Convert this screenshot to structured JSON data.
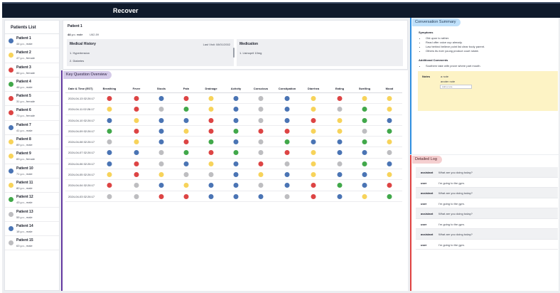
{
  "app": {
    "title": "Recover"
  },
  "colors": {
    "red": "#dd4444",
    "yellow": "#f7d35a",
    "blue": "#4a74b4",
    "green": "#41a84a",
    "gray": "#bdbdc0"
  },
  "sidebar": {
    "title": "Patients List",
    "patients": [
      {
        "name": "Patient 1",
        "info": "44 y.o., male",
        "status": "blue"
      },
      {
        "name": "Patient 2",
        "info": "47 y.o., female",
        "status": "yellow"
      },
      {
        "name": "Patient 3",
        "info": "86 y.o., female",
        "status": "red"
      },
      {
        "name": "Patient 4",
        "info": "46 y.o., male",
        "status": "green"
      },
      {
        "name": "Patient 5",
        "info": "31 y.o., female",
        "status": "red"
      },
      {
        "name": "Patient 6",
        "info": "73 y.o., female",
        "status": "red"
      },
      {
        "name": "Patient 7",
        "info": "41 y.o., male",
        "status": "blue"
      },
      {
        "name": "Patient 8",
        "info": "89 y.o., male",
        "status": "yellow"
      },
      {
        "name": "Patient 9",
        "info": "83 y.o., female",
        "status": "yellow"
      },
      {
        "name": "Patient 10",
        "info": "71 y.o., male",
        "status": "blue"
      },
      {
        "name": "Patient 11",
        "info": "80 y.o., male",
        "status": "yellow"
      },
      {
        "name": "Patient 12",
        "info": "43 y.o., male",
        "status": "green"
      },
      {
        "name": "Patient 13",
        "info": "55 y.o., male",
        "status": "gray"
      },
      {
        "name": "Patient 14",
        "info": "18 y.o., male",
        "status": "blue"
      },
      {
        "name": "Patient 15",
        "info": "63 y.o., male",
        "status": "gray"
      }
    ]
  },
  "patient": {
    "name": "Patient 1",
    "age": "44",
    "age_suffix": "y.o. male",
    "id": "U62-59",
    "medical_history": {
      "title": "Medical History",
      "last_visit": "Last Visit: 08/01/2002",
      "items": [
        "1. Hypertension",
        "2. Diabetes"
      ]
    },
    "medication": {
      "title": "Medication",
      "items": [
        "1. Lisinopril 10mg"
      ]
    }
  },
  "overview": {
    "title": "Key Question Overview",
    "columns": [
      "Date & Time (EST)",
      "Breathing",
      "Fever",
      "Stools",
      "Pain",
      "Drainage",
      "Activity",
      "Conscious",
      "Constipation",
      "Diarrhea",
      "Eating",
      "Swelling",
      "Mood"
    ],
    "rows": [
      {
        "time": "2024-04-13 02:26:17",
        "values": [
          "red",
          "red",
          "blue",
          "red",
          "yellow",
          "blue",
          "gray",
          "blue",
          "yellow",
          "red",
          "yellow",
          "yellow"
        ]
      },
      {
        "time": "2024-04-11 02:26:17",
        "values": [
          "yellow",
          "red",
          "gray",
          "green",
          "yellow",
          "blue",
          "gray",
          "blue",
          "yellow",
          "gray",
          "green",
          "yellow"
        ]
      },
      {
        "time": "2024-04-10 02:26:17",
        "values": [
          "blue",
          "yellow",
          "blue",
          "blue",
          "red",
          "blue",
          "gray",
          "blue",
          "red",
          "yellow",
          "green",
          "blue"
        ]
      },
      {
        "time": "2024-04-09 02:26:17",
        "values": [
          "green",
          "red",
          "blue",
          "yellow",
          "red",
          "green",
          "red",
          "red",
          "yellow",
          "yellow",
          "gray",
          "green"
        ]
      },
      {
        "time": "2024-04-08 02:26:17",
        "values": [
          "gray",
          "yellow",
          "blue",
          "red",
          "green",
          "blue",
          "gray",
          "green",
          "blue",
          "blue",
          "green",
          "yellow"
        ]
      },
      {
        "time": "2024-04-07 02:26:17",
        "values": [
          "blue",
          "blue",
          "gray",
          "green",
          "red",
          "green",
          "gray",
          "red",
          "yellow",
          "blue",
          "blue",
          "gray"
        ]
      },
      {
        "time": "2024-04-06 02:26:17",
        "values": [
          "blue",
          "red",
          "gray",
          "blue",
          "yellow",
          "blue",
          "red",
          "gray",
          "yellow",
          "gray",
          "green",
          "blue"
        ]
      },
      {
        "time": "2024-04-05 02:26:17",
        "values": [
          "yellow",
          "red",
          "yellow",
          "gray",
          "gray",
          "blue",
          "yellow",
          "blue",
          "yellow",
          "blue",
          "blue",
          "yellow"
        ]
      },
      {
        "time": "2024-04-04 02:26:17",
        "values": [
          "red",
          "gray",
          "blue",
          "yellow",
          "blue",
          "blue",
          "gray",
          "blue",
          "red",
          "green",
          "blue",
          "red"
        ]
      },
      {
        "time": "2024-04-03 02:26:17",
        "values": [
          "gray",
          "gray",
          "red",
          "red",
          "blue",
          "blue",
          "blue",
          "gray",
          "red",
          "blue",
          "yellow",
          "green"
        ]
      }
    ]
  },
  "summary": {
    "title": "Conversation Summary",
    "symptoms_label": "Symptoms",
    "symptoms": [
      "Old upon to rather.",
      "Read offer voice cup already.",
      "Law behind believe point list clear body parent.",
      "Others its ever young product court rotate."
    ],
    "additional_label": "Additional Comments",
    "additional": [
      "Southern take wife prove where part mouth."
    ],
    "notes_label": "Notes",
    "notes": [
      "a note",
      "anoter note"
    ],
    "notes_placeholder": "Add a note"
  },
  "log": {
    "title": "Detailed Log",
    "entries": [
      {
        "role": "assistant",
        "text": "What are you doing today?"
      },
      {
        "role": "user",
        "text": "I'm going to the gym."
      },
      {
        "role": "assistant",
        "text": "What are you doing today?"
      },
      {
        "role": "user",
        "text": "I'm going to the gym."
      },
      {
        "role": "assistant",
        "text": "What are you doing today?"
      },
      {
        "role": "user",
        "text": "I'm going to the gym."
      },
      {
        "role": "assistant",
        "text": "What are you doing today?"
      },
      {
        "role": "user",
        "text": "I'm going to the gym."
      }
    ]
  }
}
